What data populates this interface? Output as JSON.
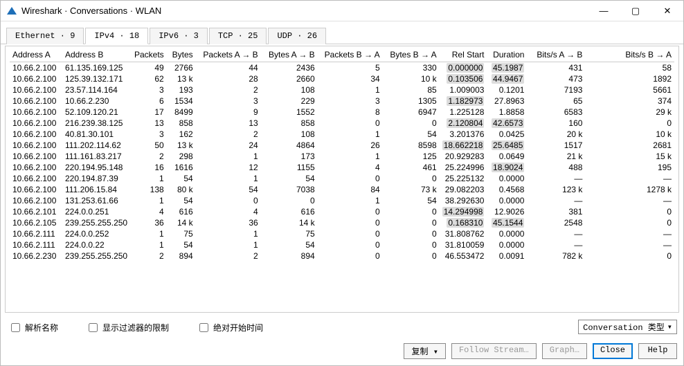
{
  "window": {
    "title": "Wireshark · Conversations · WLAN"
  },
  "tabs": [
    {
      "label": "Ethernet · 9"
    },
    {
      "label": "IPv4 · 18"
    },
    {
      "label": "IPv6 · 3"
    },
    {
      "label": "TCP · 25"
    },
    {
      "label": "UDP · 26"
    }
  ],
  "columns": {
    "addrA": "Address A",
    "addrB": "Address B",
    "packets": "Packets",
    "bytes": "Bytes",
    "pktsAB": "Packets A → B",
    "bytesAB": "Bytes A → B",
    "pktsBA": "Packets B → A",
    "bytesBA": "Bytes B → A",
    "relStart": "Rel Start",
    "duration": "Duration",
    "bitsAB": "Bits/s A → B",
    "bitsBA": "Bits/s B → A"
  },
  "rows": [
    {
      "addrA": "10.66.2.100",
      "addrB": "61.135.169.125",
      "packets": "49",
      "bytes": "2766",
      "pktsAB": "44",
      "bytesAB": "2436",
      "pktsBA": "5",
      "bytesBA": "330",
      "relStart": "0.000000",
      "duration": "45.1987",
      "bitsAB": "431",
      "bitsBA": "58",
      "hlRel": true,
      "hlDur": true
    },
    {
      "addrA": "10.66.2.100",
      "addrB": "125.39.132.171",
      "packets": "62",
      "bytes": "13 k",
      "pktsAB": "28",
      "bytesAB": "2660",
      "pktsBA": "34",
      "bytesBA": "10 k",
      "relStart": "0.103506",
      "duration": "44.9467",
      "bitsAB": "473",
      "bitsBA": "1892",
      "hlRel": true,
      "hlDur": true
    },
    {
      "addrA": "10.66.2.100",
      "addrB": "23.57.114.164",
      "packets": "3",
      "bytes": "193",
      "pktsAB": "2",
      "bytesAB": "108",
      "pktsBA": "1",
      "bytesBA": "85",
      "relStart": "1.009003",
      "duration": "0.1201",
      "bitsAB": "7193",
      "bitsBA": "5661"
    },
    {
      "addrA": "10.66.2.100",
      "addrB": "10.66.2.230",
      "packets": "6",
      "bytes": "1534",
      "pktsAB": "3",
      "bytesAB": "229",
      "pktsBA": "3",
      "bytesBA": "1305",
      "relStart": "1.182973",
      "duration": "27.8963",
      "bitsAB": "65",
      "bitsBA": "374",
      "hlRel": true
    },
    {
      "addrA": "10.66.2.100",
      "addrB": "52.109.120.21",
      "packets": "17",
      "bytes": "8499",
      "pktsAB": "9",
      "bytesAB": "1552",
      "pktsBA": "8",
      "bytesBA": "6947",
      "relStart": "1.225128",
      "duration": "1.8858",
      "bitsAB": "6583",
      "bitsBA": "29 k"
    },
    {
      "addrA": "10.66.2.100",
      "addrB": "216.239.38.125",
      "packets": "13",
      "bytes": "858",
      "pktsAB": "13",
      "bytesAB": "858",
      "pktsBA": "0",
      "bytesBA": "0",
      "relStart": "2.120804",
      "duration": "42.6573",
      "bitsAB": "160",
      "bitsBA": "0",
      "hlRel": true,
      "hlDur": true
    },
    {
      "addrA": "10.66.2.100",
      "addrB": "40.81.30.101",
      "packets": "3",
      "bytes": "162",
      "pktsAB": "2",
      "bytesAB": "108",
      "pktsBA": "1",
      "bytesBA": "54",
      "relStart": "3.201376",
      "duration": "0.0425",
      "bitsAB": "20 k",
      "bitsBA": "10 k"
    },
    {
      "addrA": "10.66.2.100",
      "addrB": "111.202.114.62",
      "packets": "50",
      "bytes": "13 k",
      "pktsAB": "24",
      "bytesAB": "4864",
      "pktsBA": "26",
      "bytesBA": "8598",
      "relStart": "18.662218",
      "duration": "25.6485",
      "bitsAB": "1517",
      "bitsBA": "2681",
      "hlRel": true,
      "hlDur": true
    },
    {
      "addrA": "10.66.2.100",
      "addrB": "111.161.83.217",
      "packets": "2",
      "bytes": "298",
      "pktsAB": "1",
      "bytesAB": "173",
      "pktsBA": "1",
      "bytesBA": "125",
      "relStart": "20.929283",
      "duration": "0.0649",
      "bitsAB": "21 k",
      "bitsBA": "15 k"
    },
    {
      "addrA": "10.66.2.100",
      "addrB": "220.194.95.148",
      "packets": "16",
      "bytes": "1616",
      "pktsAB": "12",
      "bytesAB": "1155",
      "pktsBA": "4",
      "bytesBA": "461",
      "relStart": "25.224996",
      "duration": "18.9024",
      "bitsAB": "488",
      "bitsBA": "195",
      "hlDur": true
    },
    {
      "addrA": "10.66.2.100",
      "addrB": "220.194.87.39",
      "packets": "1",
      "bytes": "54",
      "pktsAB": "1",
      "bytesAB": "54",
      "pktsBA": "0",
      "bytesBA": "0",
      "relStart": "25.225132",
      "duration": "0.0000",
      "bitsAB": "—",
      "bitsBA": "—"
    },
    {
      "addrA": "10.66.2.100",
      "addrB": "111.206.15.84",
      "packets": "138",
      "bytes": "80 k",
      "pktsAB": "54",
      "bytesAB": "7038",
      "pktsBA": "84",
      "bytesBA": "73 k",
      "relStart": "29.082203",
      "duration": "0.4568",
      "bitsAB": "123 k",
      "bitsBA": "1278 k"
    },
    {
      "addrA": "10.66.2.100",
      "addrB": "131.253.61.66",
      "packets": "1",
      "bytes": "54",
      "pktsAB": "0",
      "bytesAB": "0",
      "pktsBA": "1",
      "bytesBA": "54",
      "relStart": "38.292630",
      "duration": "0.0000",
      "bitsAB": "—",
      "bitsBA": "—"
    },
    {
      "addrA": "10.66.2.101",
      "addrB": "224.0.0.251",
      "packets": "4",
      "bytes": "616",
      "pktsAB": "4",
      "bytesAB": "616",
      "pktsBA": "0",
      "bytesBA": "0",
      "relStart": "14.294998",
      "duration": "12.9026",
      "bitsAB": "381",
      "bitsBA": "0",
      "hlRel": true
    },
    {
      "addrA": "10.66.2.105",
      "addrB": "239.255.255.250",
      "packets": "36",
      "bytes": "14 k",
      "pktsAB": "36",
      "bytesAB": "14 k",
      "pktsBA": "0",
      "bytesBA": "0",
      "relStart": "0.168310",
      "duration": "45.1544",
      "bitsAB": "2548",
      "bitsBA": "0",
      "hlRel": true,
      "hlDur": true
    },
    {
      "addrA": "10.66.2.111",
      "addrB": "224.0.0.252",
      "packets": "1",
      "bytes": "75",
      "pktsAB": "1",
      "bytesAB": "75",
      "pktsBA": "0",
      "bytesBA": "0",
      "relStart": "31.808762",
      "duration": "0.0000",
      "bitsAB": "—",
      "bitsBA": "—"
    },
    {
      "addrA": "10.66.2.111",
      "addrB": "224.0.0.22",
      "packets": "1",
      "bytes": "54",
      "pktsAB": "1",
      "bytesAB": "54",
      "pktsBA": "0",
      "bytesBA": "0",
      "relStart": "31.810059",
      "duration": "0.0000",
      "bitsAB": "—",
      "bitsBA": "—"
    },
    {
      "addrA": "10.66.2.230",
      "addrB": "239.255.255.250",
      "packets": "2",
      "bytes": "894",
      "pktsAB": "2",
      "bytesAB": "894",
      "pktsBA": "0",
      "bytesBA": "0",
      "relStart": "46.553472",
      "duration": "0.0091",
      "bitsAB": "782 k",
      "bitsBA": "0"
    }
  ],
  "checkboxes": {
    "resolve": "解析名称",
    "limitFilter": "显示过滤器的限制",
    "absoluteStart": "绝对开始时间"
  },
  "dropdown": {
    "convType": "Conversation 类型"
  },
  "buttons": {
    "copy": "复制",
    "follow": "Follow Stream…",
    "graph": "Graph…",
    "close": "Close",
    "help": "Help"
  }
}
